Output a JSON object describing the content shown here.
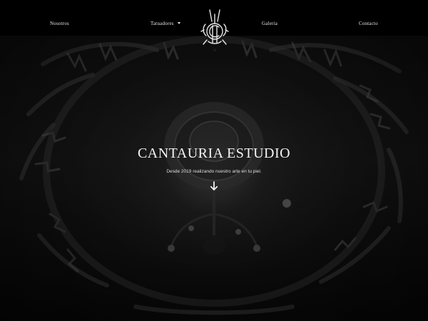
{
  "nav": {
    "items": [
      {
        "label": "Nosotros"
      },
      {
        "label": "Tatuadores"
      },
      {
        "label": "Galeria"
      },
      {
        "label": "Contacto"
      }
    ]
  },
  "hero": {
    "title": "CANTAURIA ESTUDIO",
    "subtitle": "Desde 2019 realizando nuestro arte en tu piel.",
    "scroll_icon": "arrow-down-icon"
  },
  "logo": {
    "icon": "ornate-monogram-logo"
  },
  "colors": {
    "nav_background": "#000000",
    "text": "#e6e6e6",
    "page_background": "#0b0b0b"
  }
}
